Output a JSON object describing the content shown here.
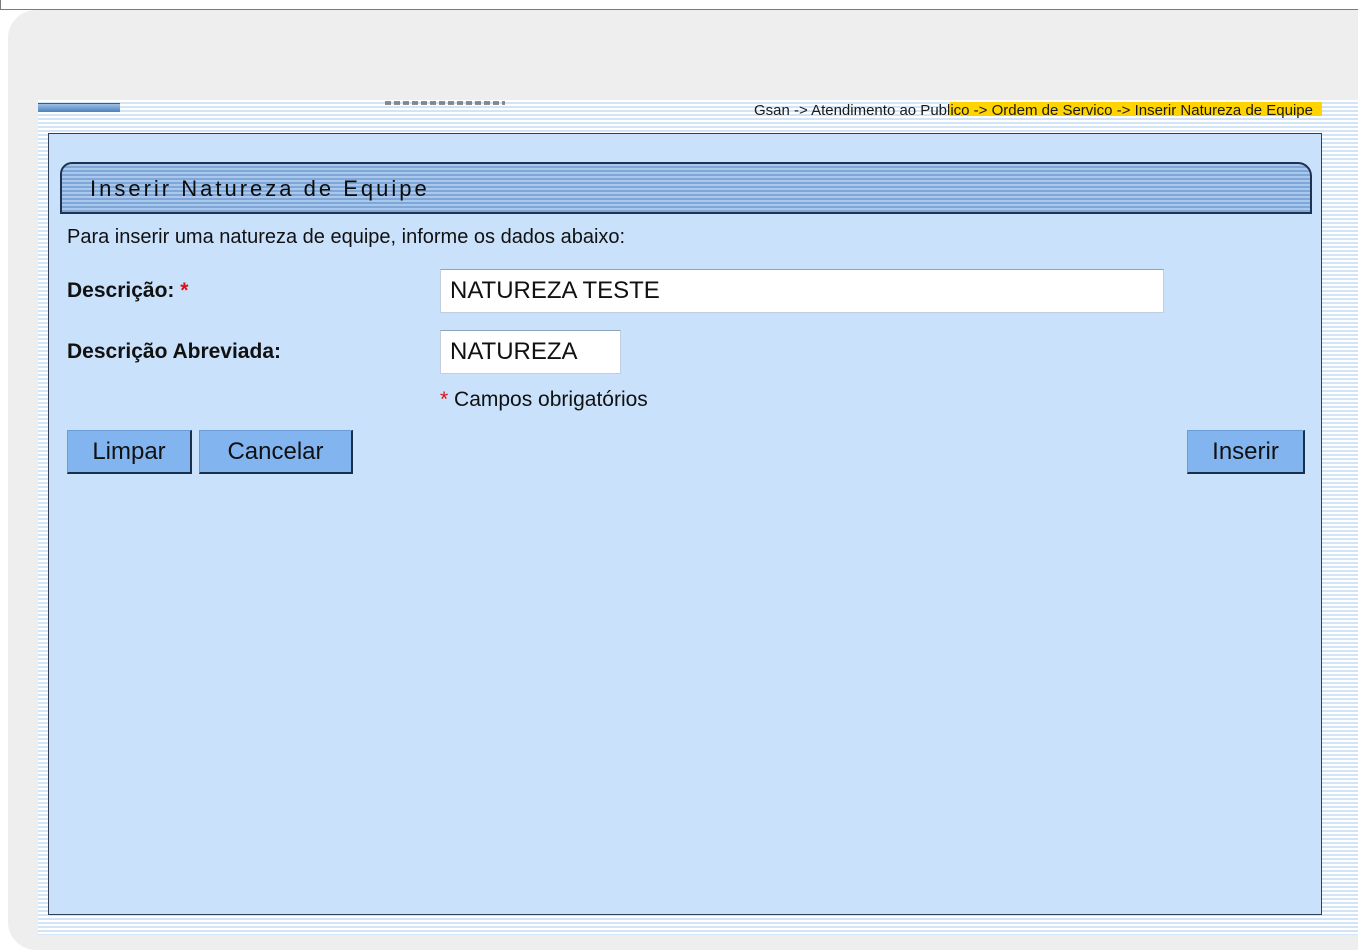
{
  "breadcrumb": "Gsan -> Atendimento ao Publico -> Ordem de Servico -> Inserir Natureza de Equipe",
  "form": {
    "title": "Inserir Natureza de Equipe",
    "instruction": "Para inserir uma natureza de equipe, informe os dados abaixo:",
    "fields": {
      "descricao": {
        "label": "Descrição:",
        "required_mark": "*",
        "value": "NATUREZA TESTE"
      },
      "descricao_abreviada": {
        "label": "Descrição Abreviada:",
        "value": "NATUREZA"
      }
    },
    "required_note": {
      "mark": "*",
      "text": "Campos obrigatórios"
    },
    "buttons": {
      "limpar": "Limpar",
      "cancelar": "Cancelar",
      "inserir": "Inserir"
    }
  },
  "colors": {
    "panel_background": "#c9e1fa",
    "button_background": "#82b4ef",
    "required_star": "#dd1111",
    "breadcrumb_highlight": "#ffd400"
  }
}
